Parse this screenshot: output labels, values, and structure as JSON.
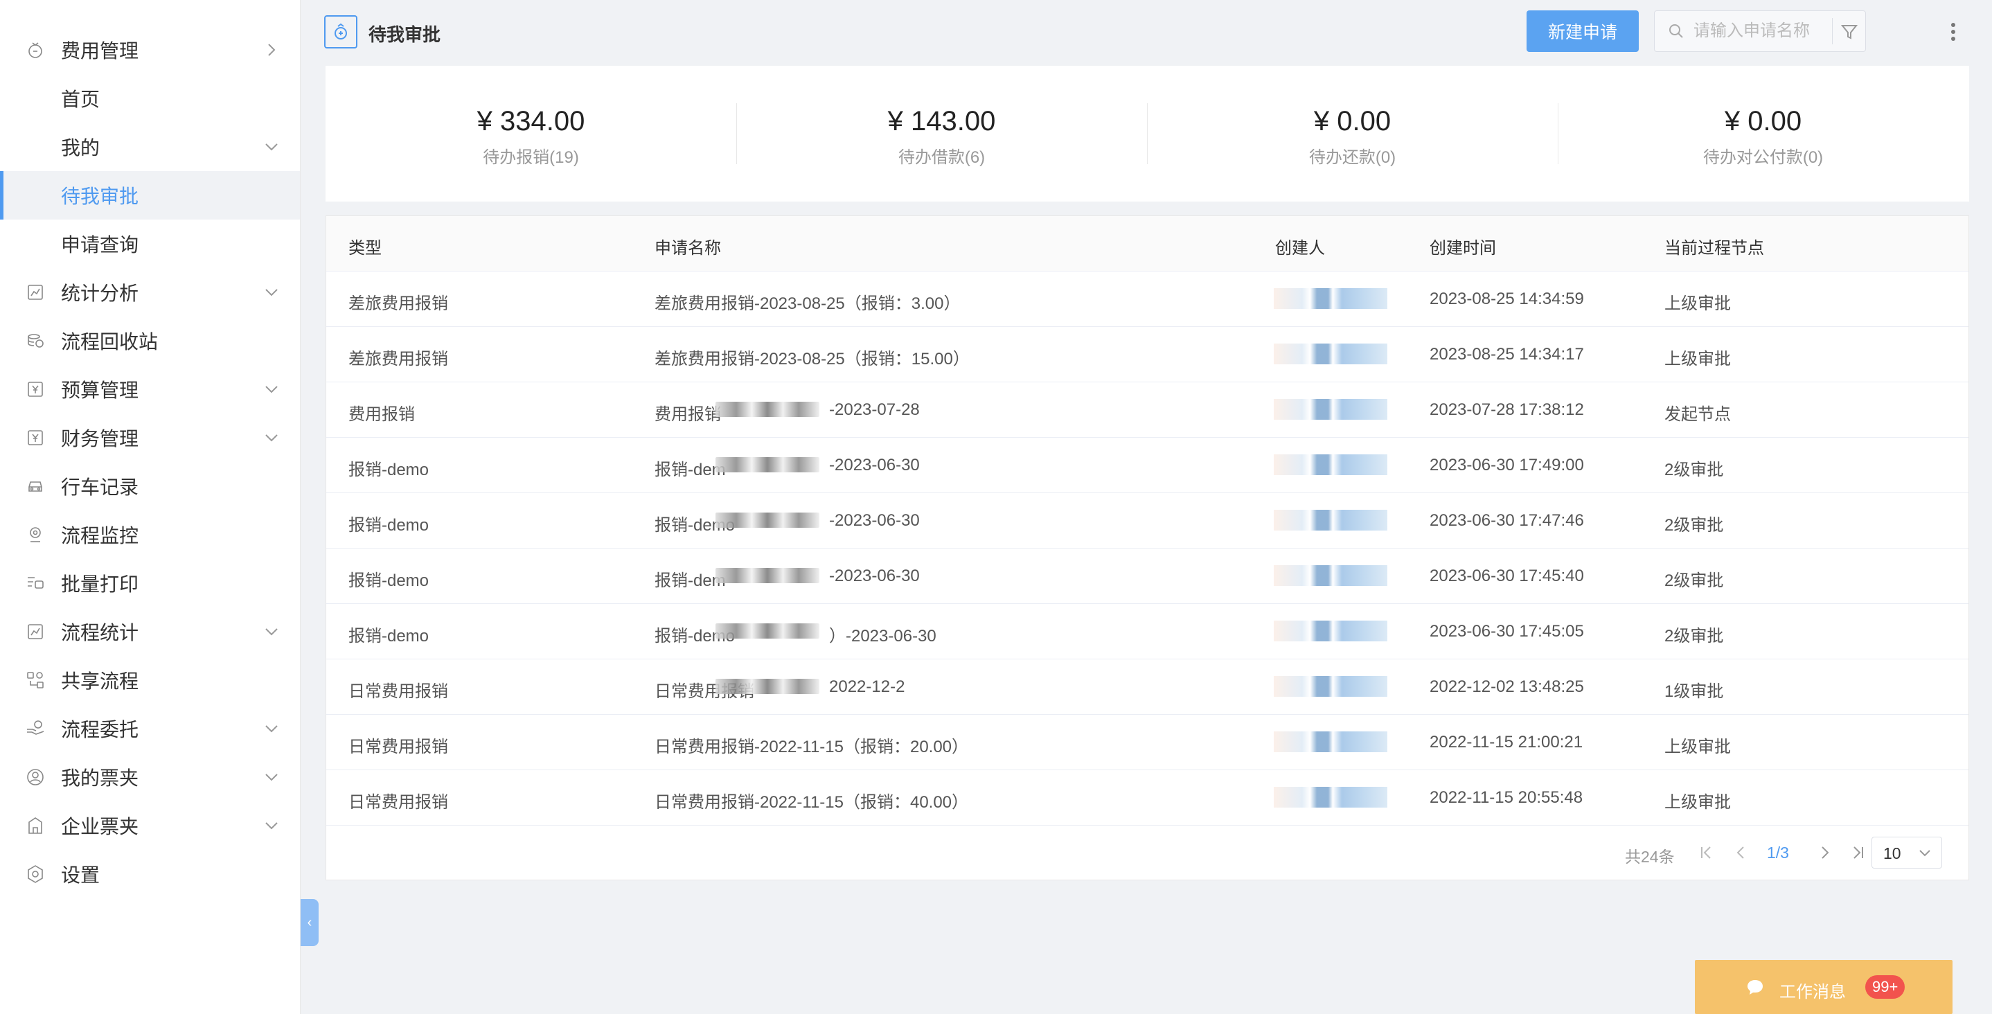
{
  "sidebar": {
    "items": [
      {
        "label": "费用管理",
        "icon": "coin-bag-icon",
        "chevron": "right"
      },
      {
        "label": "首页"
      },
      {
        "label": "我的",
        "chevron": "down"
      },
      {
        "label": "待我审批",
        "active": true
      },
      {
        "label": "申请查询"
      },
      {
        "label": "统计分析",
        "icon": "chart-icon",
        "chevron": "down"
      },
      {
        "label": "流程回收站",
        "icon": "coins-stack-icon"
      },
      {
        "label": "预算管理",
        "icon": "yen-doc-icon",
        "chevron": "down"
      },
      {
        "label": "财务管理",
        "icon": "yen-doc-icon",
        "chevron": "down"
      },
      {
        "label": "行车记录",
        "icon": "car-icon"
      },
      {
        "label": "流程监控",
        "icon": "monitor-icon"
      },
      {
        "label": "批量打印",
        "icon": "print-list-icon"
      },
      {
        "label": "流程统计",
        "icon": "chart-icon",
        "chevron": "down"
      },
      {
        "label": "共享流程",
        "icon": "share-flow-icon"
      },
      {
        "label": "流程委托",
        "icon": "hand-coin-icon",
        "chevron": "down"
      },
      {
        "label": "我的票夹",
        "icon": "user-circle-icon",
        "chevron": "down"
      },
      {
        "label": "企业票夹",
        "icon": "building-icon",
        "chevron": "down"
      },
      {
        "label": "设置",
        "icon": "settings-hex-icon"
      }
    ]
  },
  "header": {
    "title": "待我审批",
    "new_button": "新建申请",
    "search_placeholder": "请输入申请名称"
  },
  "summary": [
    {
      "amount": "¥ 334.00",
      "label": "待办报销(19)"
    },
    {
      "amount": "¥ 143.00",
      "label": "待办借款(6)"
    },
    {
      "amount": "¥ 0.00",
      "label": "待办还款(0)"
    },
    {
      "amount": "¥ 0.00",
      "label": "待办对公付款(0)"
    }
  ],
  "table": {
    "columns": [
      "类型",
      "申请名称",
      "创建人",
      "创建时间",
      "当前过程节点"
    ],
    "rows": [
      {
        "type": "差旅费用报销",
        "name": "差旅费用报销-2023-08-25（报销：3.00）",
        "created": "2023-08-25 14:34:59",
        "node": "上级审批"
      },
      {
        "type": "差旅费用报销",
        "name": "差旅费用报销-2023-08-25（报销：15.00）",
        "created": "2023-08-25 14:34:17",
        "node": "上级审批"
      },
      {
        "type": "费用报销",
        "name_pre": "费用报销",
        "name_post": "-2023-07-28",
        "created": "2023-07-28 17:38:12",
        "node": "发起节点"
      },
      {
        "type": "报销-demo",
        "name_pre": "报销-dem",
        "name_post": "-2023-06-30",
        "created": "2023-06-30 17:49:00",
        "node": "2级审批"
      },
      {
        "type": "报销-demo",
        "name_pre": "报销-demo",
        "name_post": "-2023-06-30",
        "created": "2023-06-30 17:47:46",
        "node": "2级审批"
      },
      {
        "type": "报销-demo",
        "name_pre": "报销-dem",
        "name_post": "-2023-06-30",
        "created": "2023-06-30 17:45:40",
        "node": "2级审批"
      },
      {
        "type": "报销-demo",
        "name_pre": "报销-demo",
        "name_post": "）-2023-06-30",
        "created": "2023-06-30 17:45:05",
        "node": "2级审批"
      },
      {
        "type": "日常费用报销",
        "name_pre": "日常费用报销",
        "name_post": "2022-12-2",
        "created": "2022-12-02 13:48:25",
        "node": "1级审批"
      },
      {
        "type": "日常费用报销",
        "name": "日常费用报销-2022-11-15（报销：20.00）",
        "created": "2022-11-15 21:00:21",
        "node": "上级审批"
      },
      {
        "type": "日常费用报销",
        "name": "日常费用报销-2022-11-15（报销：40.00）",
        "created": "2022-11-15 20:55:48",
        "node": "上级审批"
      }
    ]
  },
  "pagination": {
    "total": "共24条",
    "page": "1/3",
    "page_size": "10"
  },
  "messages": {
    "label": "工作消息",
    "badge": "99+"
  },
  "colors": {
    "accent": "#4f9af0",
    "button": "#5ba3f1",
    "message_bar": "#f5c26b",
    "badge": "#f2534d"
  }
}
